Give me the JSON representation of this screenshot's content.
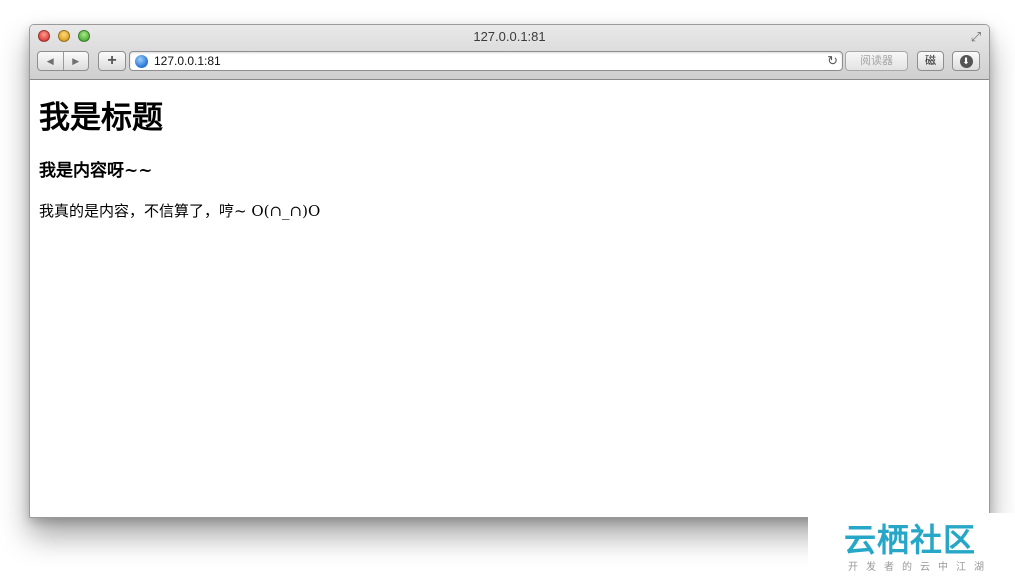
{
  "window": {
    "title": "127.0.0.1:81"
  },
  "toolbar": {
    "back_icon": "◀",
    "forward_icon": "▶",
    "add_icon": "+",
    "url": "127.0.0.1:81",
    "reload_icon": "↻",
    "reader_label": "阅读器",
    "extension_label": "磁",
    "download_icon": "⬇"
  },
  "page": {
    "heading": "我是标题",
    "subheading": "我是内容呀~~",
    "paragraph": "我真的是内容，不信算了，哼~ O(∩_∩)O"
  },
  "watermark": {
    "main": "云栖社区",
    "sub": "开发者的云中江湖"
  }
}
